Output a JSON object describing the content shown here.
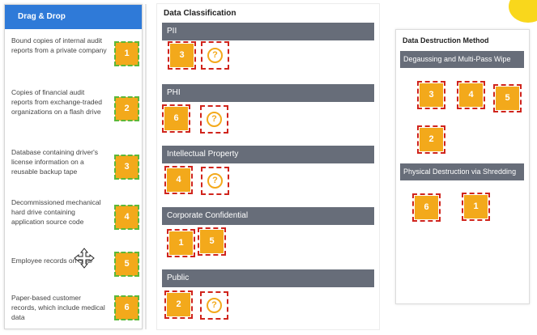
{
  "left": {
    "header": "Drag & Drop",
    "items": [
      {
        "text": "Bound copies of internal audit reports from a private company",
        "tile": "1"
      },
      {
        "text": "Copies of financial audit reports from exchange-traded organizations on a flash drive",
        "tile": "2"
      },
      {
        "text": "Database containing driver's license information on a reusable backup tape",
        "tile": "3"
      },
      {
        "text": "Decommissioned mechanical hard drive containing application source code",
        "tile": "4"
      },
      {
        "text": "Employee records on SSD",
        "tile": "5"
      },
      {
        "text": "Paper-based customer records, which include medical data",
        "tile": "6"
      }
    ]
  },
  "middle": {
    "title": "Data Classification",
    "categories": [
      {
        "label": "PII",
        "tiles": [
          "3"
        ],
        "placeholder": "?"
      },
      {
        "label": "PHI",
        "tiles": [
          "6"
        ],
        "placeholder": "?"
      },
      {
        "label": "Intellectual Property",
        "tiles": [
          "4"
        ],
        "placeholder": "?"
      },
      {
        "label": "Corporate Confidential",
        "tiles": [
          "1",
          "5"
        ]
      },
      {
        "label": "Public",
        "tiles": [
          "2"
        ],
        "placeholder": "?"
      }
    ]
  },
  "right": {
    "title": "Data Destruction Method",
    "methods": [
      {
        "label": "Degaussing and Multi-Pass Wipe",
        "tiles": [
          "3",
          "4",
          "5",
          "2"
        ]
      },
      {
        "label": "Physical Destruction via Shredding",
        "tiles": [
          "6",
          "1"
        ]
      }
    ]
  },
  "colors": {
    "accent": "#2f7ad8",
    "tile": "#f3a91b",
    "bar": "#676d79",
    "dash_red": "#d0241c",
    "dash_green": "#5cb83a"
  }
}
